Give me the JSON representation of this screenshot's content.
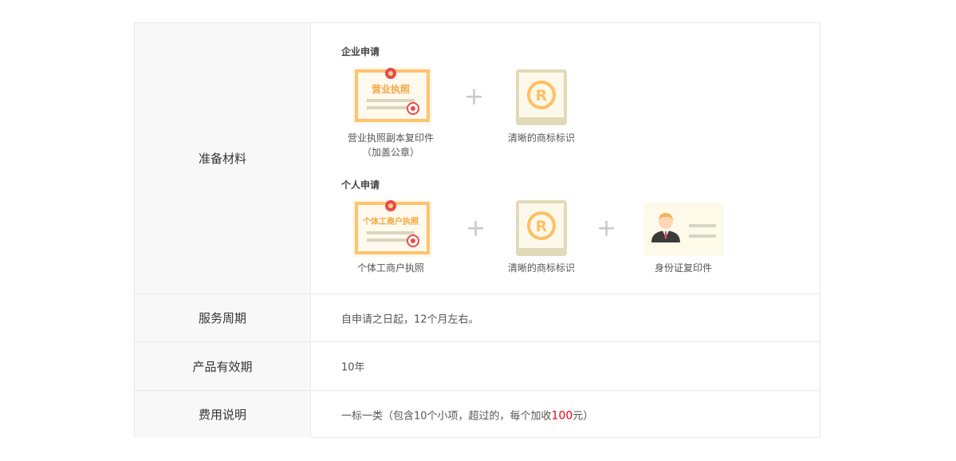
{
  "rows": [
    {
      "label": "准备材料",
      "enterprise": {
        "title": "企业申请",
        "license_text": "营业执照",
        "items": [
          "营业执照副本复印件\n（加盖公章）",
          "清晰的商标标识"
        ]
      },
      "personal": {
        "title": "个人申请",
        "license_text": "个体工商户执照",
        "items": [
          "个体工商户执照",
          "清晰的商标标识",
          "身份证复印件"
        ]
      },
      "plus": "+"
    },
    {
      "label": "服务周期",
      "value": "自申请之日起，12个月左右。"
    },
    {
      "label": "产品有效期",
      "value": "10年"
    },
    {
      "label": "费用说明",
      "value_pre": "一标一类（包含10个小项，超过的，每个加收",
      "value_highlight": "100",
      "value_post": "元）"
    }
  ],
  "colors": {
    "accent_red": "#e60012",
    "license_orange": "#ffc36e",
    "seal_red": "#e84b4b",
    "mark_beige": "#e9e4c6"
  }
}
